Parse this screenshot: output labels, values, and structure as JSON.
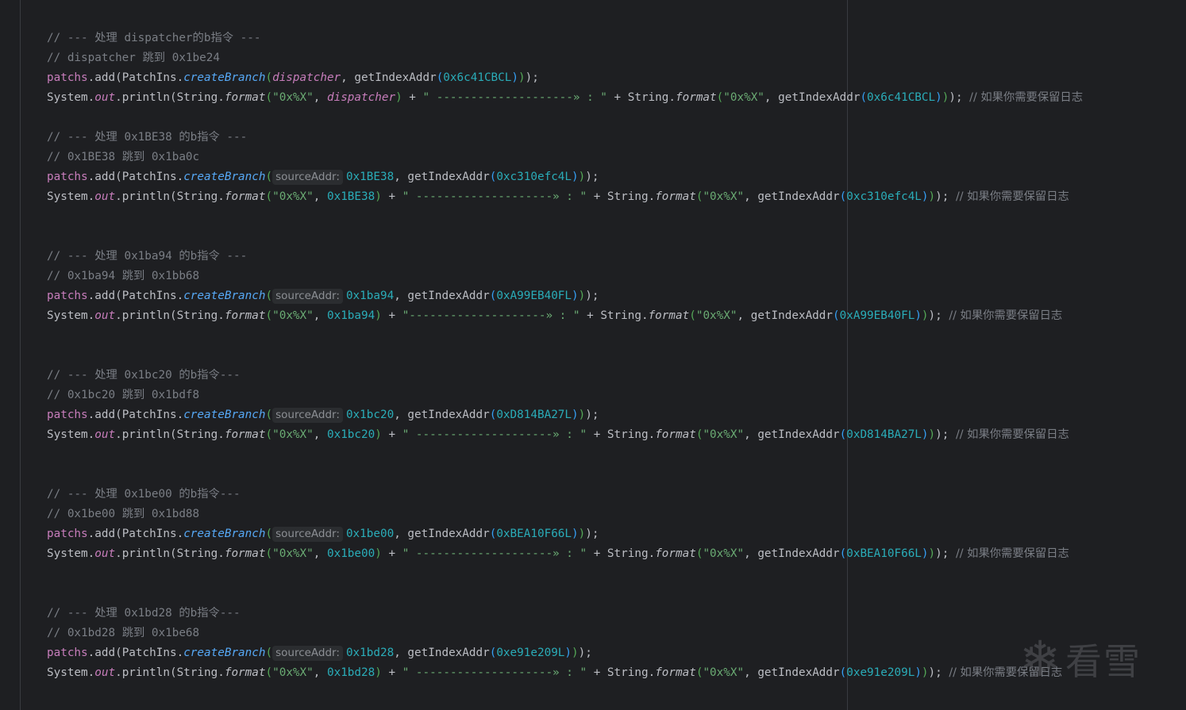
{
  "watermark": {
    "text": "看雪"
  },
  "blocks": [
    {
      "heading_prefix": "// --- ",
      "heading_cjk": "处理",
      "heading_rest": " dispatcher的b指令 ---",
      "jump_prefix": "// dispatcher ",
      "jump_cjk": "跳到",
      "jump_rest": " 0x1be24",
      "source": "dispatcher",
      "source_is_field": true,
      "target_const": "0x6c41CBCL",
      "arrow_string": "\" --------------------» : \"",
      "trailing_comment": "// 如果你需要保留日志"
    },
    {
      "heading_prefix": "// --- ",
      "heading_cjk": "处理",
      "heading_rest": " 0x1BE38 的b指令 ---",
      "jump_prefix": "// 0x1BE38 ",
      "jump_cjk": "跳到",
      "jump_rest": " 0x1ba0c",
      "hint": "sourceAddr:",
      "source": "0x1BE38",
      "target_const": "0xc310efc4L",
      "arrow_string": "\" --------------------» : \"",
      "trailing_comment": "// 如果你需要保留日志"
    },
    {
      "heading_prefix": "// --- ",
      "heading_cjk": "处理",
      "heading_rest": " 0x1ba94 的b指令 ---",
      "jump_prefix": "// 0x1ba94 ",
      "jump_cjk": "跳到",
      "jump_rest": " 0x1bb68",
      "hint": "sourceAddr:",
      "source": "0x1ba94",
      "target_const": "0xA99EB40FL",
      "arrow_string": "\"--------------------» : \"",
      "trailing_comment": "// 如果你需要保留日志"
    },
    {
      "heading_prefix": "// --- ",
      "heading_cjk": "处理",
      "heading_rest": " 0x1bc20 的b指令---",
      "jump_prefix": "// 0x1bc20 ",
      "jump_cjk": "跳到",
      "jump_rest": " 0x1bdf8",
      "hint": "sourceAddr:",
      "source": "0x1bc20",
      "target_const": "0xD814BA27L",
      "arrow_string": "\" --------------------» : \"",
      "trailing_comment": "// 如果你需要保留日志"
    },
    {
      "heading_prefix": "// --- ",
      "heading_cjk": "处理",
      "heading_rest": " 0x1be00 的b指令---",
      "jump_prefix": "// 0x1be00 ",
      "jump_cjk": "跳到",
      "jump_rest": " 0x1bd88",
      "hint": "sourceAddr:",
      "source": "0x1be00",
      "target_const": "0xBEA10F66L",
      "arrow_string": "\" --------------------» : \"",
      "trailing_comment": "// 如果你需要保留日志"
    },
    {
      "heading_prefix": "// --- ",
      "heading_cjk": "处理",
      "heading_rest": " 0x1bd28 的b指令---",
      "jump_prefix": "// 0x1bd28 ",
      "jump_cjk": "跳到",
      "jump_rest": " 0x1be68",
      "hint": "sourceAddr:",
      "source": "0x1bd28",
      "target_const": "0xe91e209L",
      "arrow_string": "\" --------------------» : \"",
      "trailing_comment": "// 如果你需要保留日志"
    }
  ],
  "blank_lines_after": [
    1,
    2,
    2,
    2,
    2,
    0
  ],
  "code": {
    "patchs": "patchs",
    "add": ".add",
    "patchins": "PatchIns",
    "create_branch": "createBranch",
    "get_index_addr": "getIndexAddr",
    "system": "System",
    "out": "out",
    "println": "println",
    "string_cls": "String",
    "format": "format",
    "fmt_string": "\"0x%X\""
  }
}
